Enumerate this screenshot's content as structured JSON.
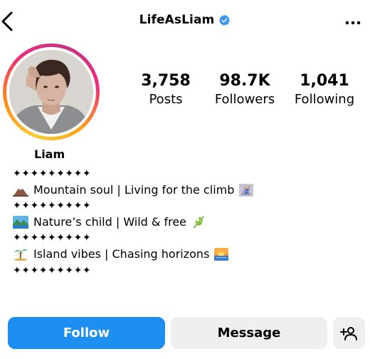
{
  "header": {
    "username": "LifeAsLiam",
    "verified_color": "#3897f0"
  },
  "stats": [
    {
      "value": "3,758",
      "label": "Posts"
    },
    {
      "value": "98.7K",
      "label": "Followers"
    },
    {
      "value": "1,041",
      "label": "Following"
    }
  ],
  "profile": {
    "name": "Liam",
    "bio": [
      {
        "text": "✦✦✦✦✦✦✦✦✦"
      },
      {
        "icon": "mountain-emoji-icon",
        "text": "Mountain soul | Living for the climb",
        "icon_after": "climber-emoji-icon"
      },
      {
        "text": "✦✦✦✦✦✦✦✦✦"
      },
      {
        "icon": "lake-landscape-emoji-icon",
        "text": "Nature’s child | Wild & free",
        "icon_after": "herb-emoji-icon"
      },
      {
        "text": "✦✦✦✦✦✦✦✦✦"
      },
      {
        "icon": "palm-island-emoji-icon",
        "text": "Island vibes | Chasing horizons",
        "icon_after": "sunrise-emoji-icon"
      },
      {
        "text": "✦✦✦✦✦✦✦✦✦"
      }
    ]
  },
  "actions": {
    "follow_label": "Follow",
    "message_label": "Message",
    "follow_color": "#1d8ff2",
    "secondary_color": "#efefef"
  },
  "icons": {
    "back": "chevron-left-icon",
    "more": "more-horizontal-icon",
    "add_person": "add-person-icon"
  }
}
